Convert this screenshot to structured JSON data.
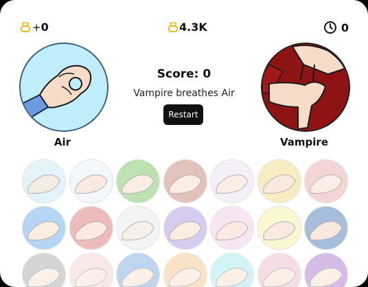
{
  "stats": {
    "left_prefix": "+",
    "left_value": "0",
    "middle_value": "4.3K",
    "right_value": "0",
    "left_icon": "bell-coin-icon",
    "middle_icon": "bell-coin-icon",
    "right_icon": "clock-icon"
  },
  "player": {
    "label": "Air",
    "bg": "#bfeefa"
  },
  "opponent": {
    "label": "Vampire",
    "bg": "#8e1414"
  },
  "score_text": "Score: 0",
  "result_text": "Vampire breathes Air",
  "restart_label": "Restart",
  "tiles": [
    {
      "color": "#bfe6f5",
      "accent": "#e9d6c3"
    },
    {
      "color": "#e6eef5",
      "accent": "#f2d0b8"
    },
    {
      "color": "#6fbf55",
      "accent": "#f4d7c0"
    },
    {
      "color": "#c07a6a",
      "accent": "#f5d8c3"
    },
    {
      "color": "#e8dcf2",
      "accent": "#f5d8c6"
    },
    {
      "color": "#f0d67a",
      "accent": "#f3d1b8"
    },
    {
      "color": "#e8a4a4",
      "accent": "#f4dcca"
    },
    {
      "color": "#5aa6e8",
      "accent": "#f4d6b8"
    },
    {
      "color": "#d96a6a",
      "accent": "#f4d3bf"
    },
    {
      "color": "#e8e8e8",
      "accent": "#f5dcc8"
    },
    {
      "color": "#a88fe0",
      "accent": "#f4d6be"
    },
    {
      "color": "#f0c6e6",
      "accent": "#f4d1bf"
    },
    {
      "color": "#f5ef9a",
      "accent": "#f3d2bd"
    },
    {
      "color": "#3b6fb3",
      "accent": "#f2cdb4"
    },
    {
      "color": "#888888",
      "accent": "#f4d6c0"
    },
    {
      "color": "#f0c0c0",
      "accent": "#f4d6c0"
    },
    {
      "color": "#4a86d0",
      "accent": "#f4d6c0"
    },
    {
      "color": "#f0b060",
      "accent": "#f4d6c0"
    },
    {
      "color": "#7fe0e8",
      "accent": "#f4d6c0"
    },
    {
      "color": "#e2a0b0",
      "accent": "#f4d6c0"
    },
    {
      "color": "#8a40c0",
      "accent": "#f4d6c0"
    }
  ]
}
